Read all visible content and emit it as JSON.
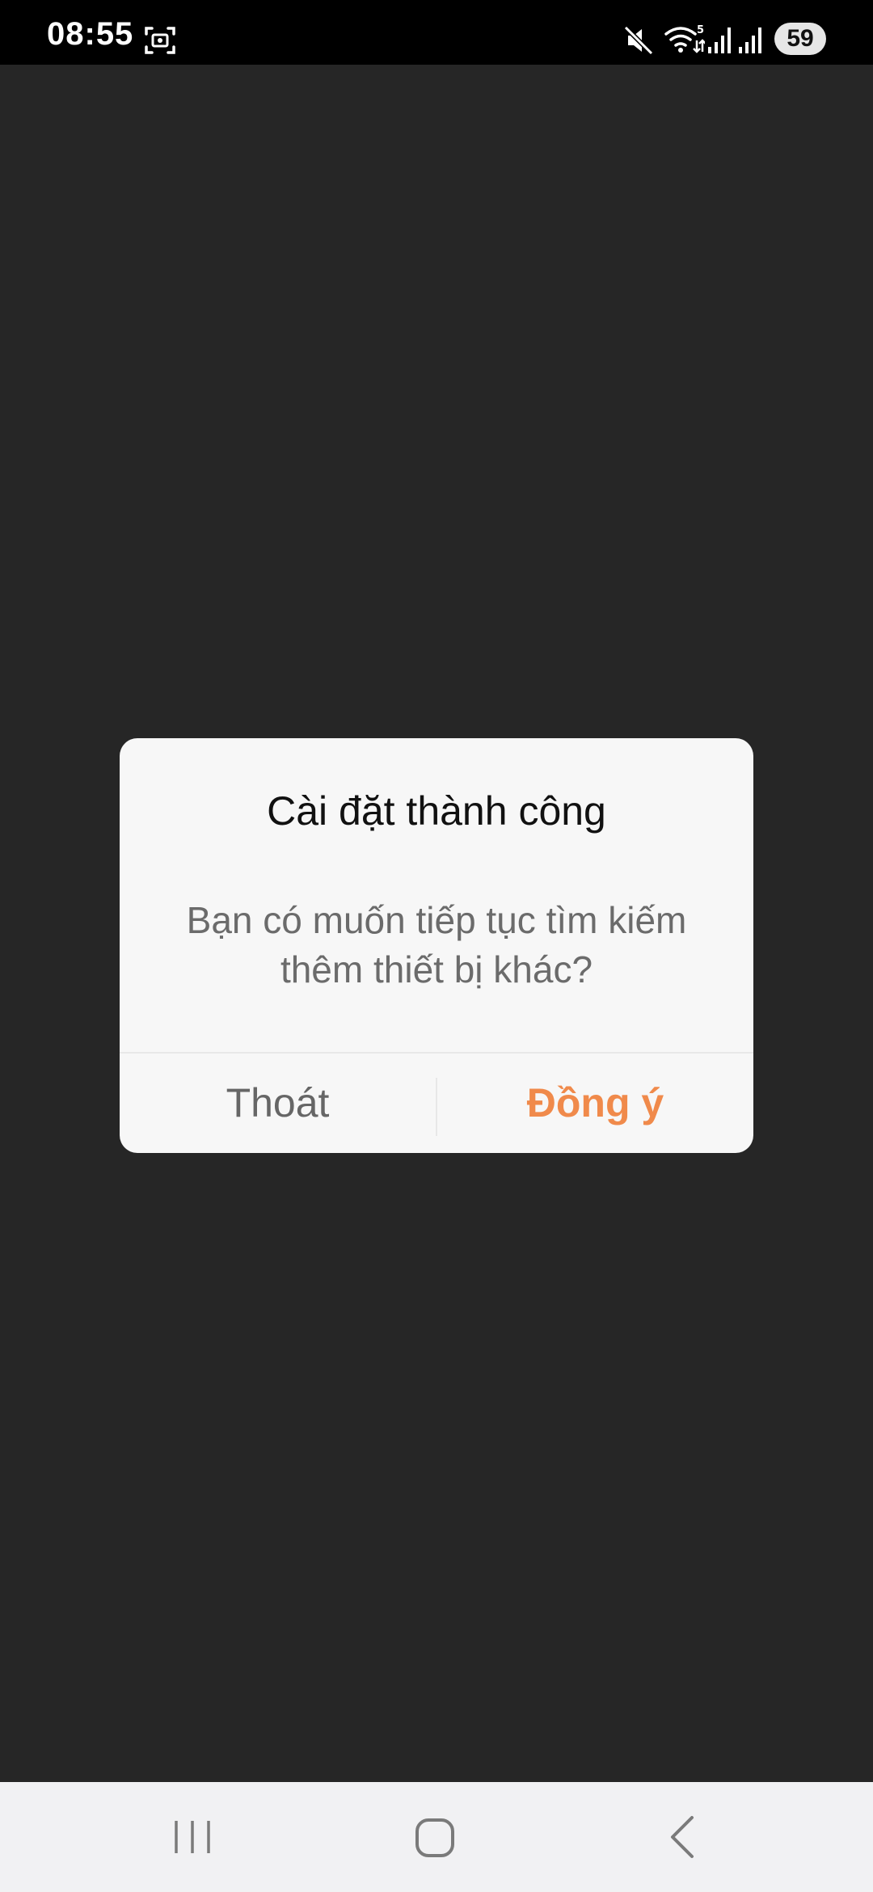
{
  "status_bar": {
    "time": "08:55",
    "battery_level": "59",
    "icons": [
      "screenshot-icon",
      "mute-icon",
      "wifi-icon",
      "signal-icon",
      "signal-icon"
    ]
  },
  "dialog": {
    "title": "Cài đặt thành công",
    "message": "Bạn có muốn tiếp tục tìm kiếm thêm thiết bị khác?",
    "exit_label": "Thoát",
    "agree_label": "Đồng ý"
  },
  "colors": {
    "background": "#262626",
    "dialog_background": "#f7f7f7",
    "accent": "#f08a4b",
    "secondary_text": "#666666"
  },
  "nav_bar": {
    "icons": [
      "recents-icon",
      "home-icon",
      "back-icon"
    ]
  }
}
